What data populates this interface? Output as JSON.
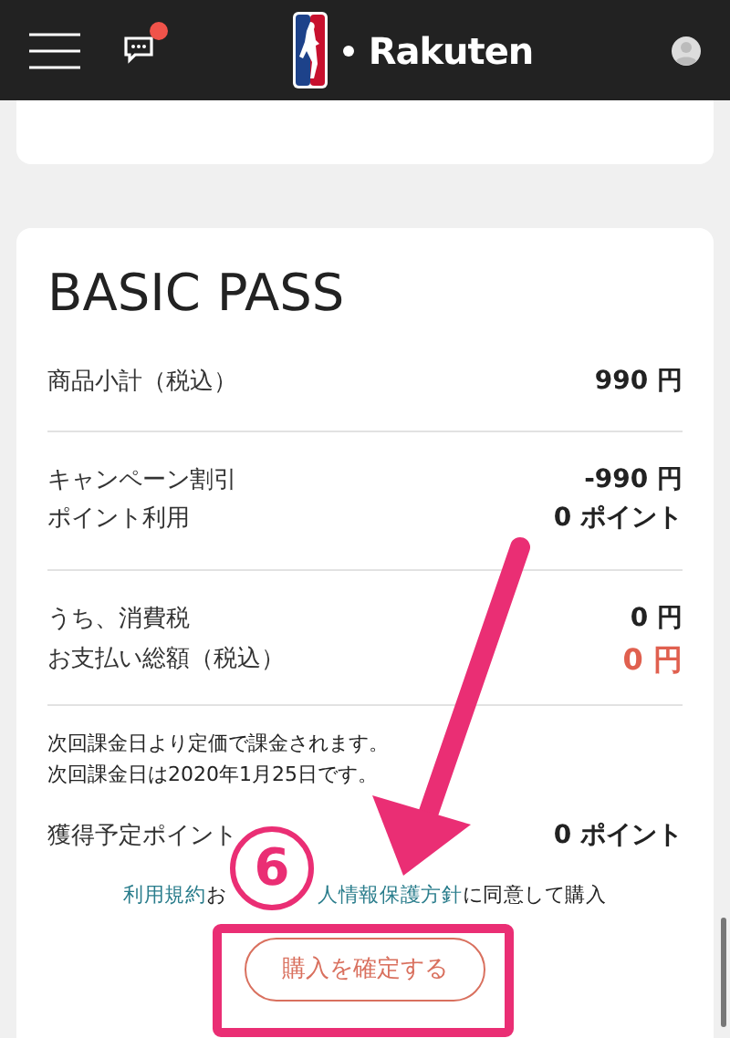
{
  "header": {
    "brand": "Rakuten",
    "has_notification": true
  },
  "plan": {
    "title": "BASIC PASS"
  },
  "summary_groups": [
    {
      "rows": [
        {
          "label": "商品小計（税込）",
          "value": "990 円",
          "highlight": false
        }
      ]
    },
    {
      "rows": [
        {
          "label": "キャンペーン割引",
          "value": "-990 円",
          "highlight": false
        },
        {
          "label": "ポイント利用",
          "value": "0 ポイント",
          "highlight": false
        }
      ]
    },
    {
      "rows": [
        {
          "label": "うち、消費税",
          "value": "0 円",
          "highlight": false
        },
        {
          "label": "お支払い総額（税込）",
          "value": "0 円",
          "highlight": true
        }
      ]
    }
  ],
  "notes": [
    "次回課金日より定価で課金されます。",
    "次回課金日は2020年1月25日です。"
  ],
  "points": {
    "label": "獲得予定ポイント",
    "value": "0 ポイント"
  },
  "agreement": [
    {
      "kind": "link",
      "text": "利用規約"
    },
    {
      "kind": "text",
      "text": "お"
    },
    {
      "kind": "link",
      "text": "人情報保護方針"
    },
    {
      "kind": "text",
      "text": "に同意して購入"
    }
  ],
  "confirm_button": "購入を確定する",
  "annotation": {
    "step": "6"
  }
}
